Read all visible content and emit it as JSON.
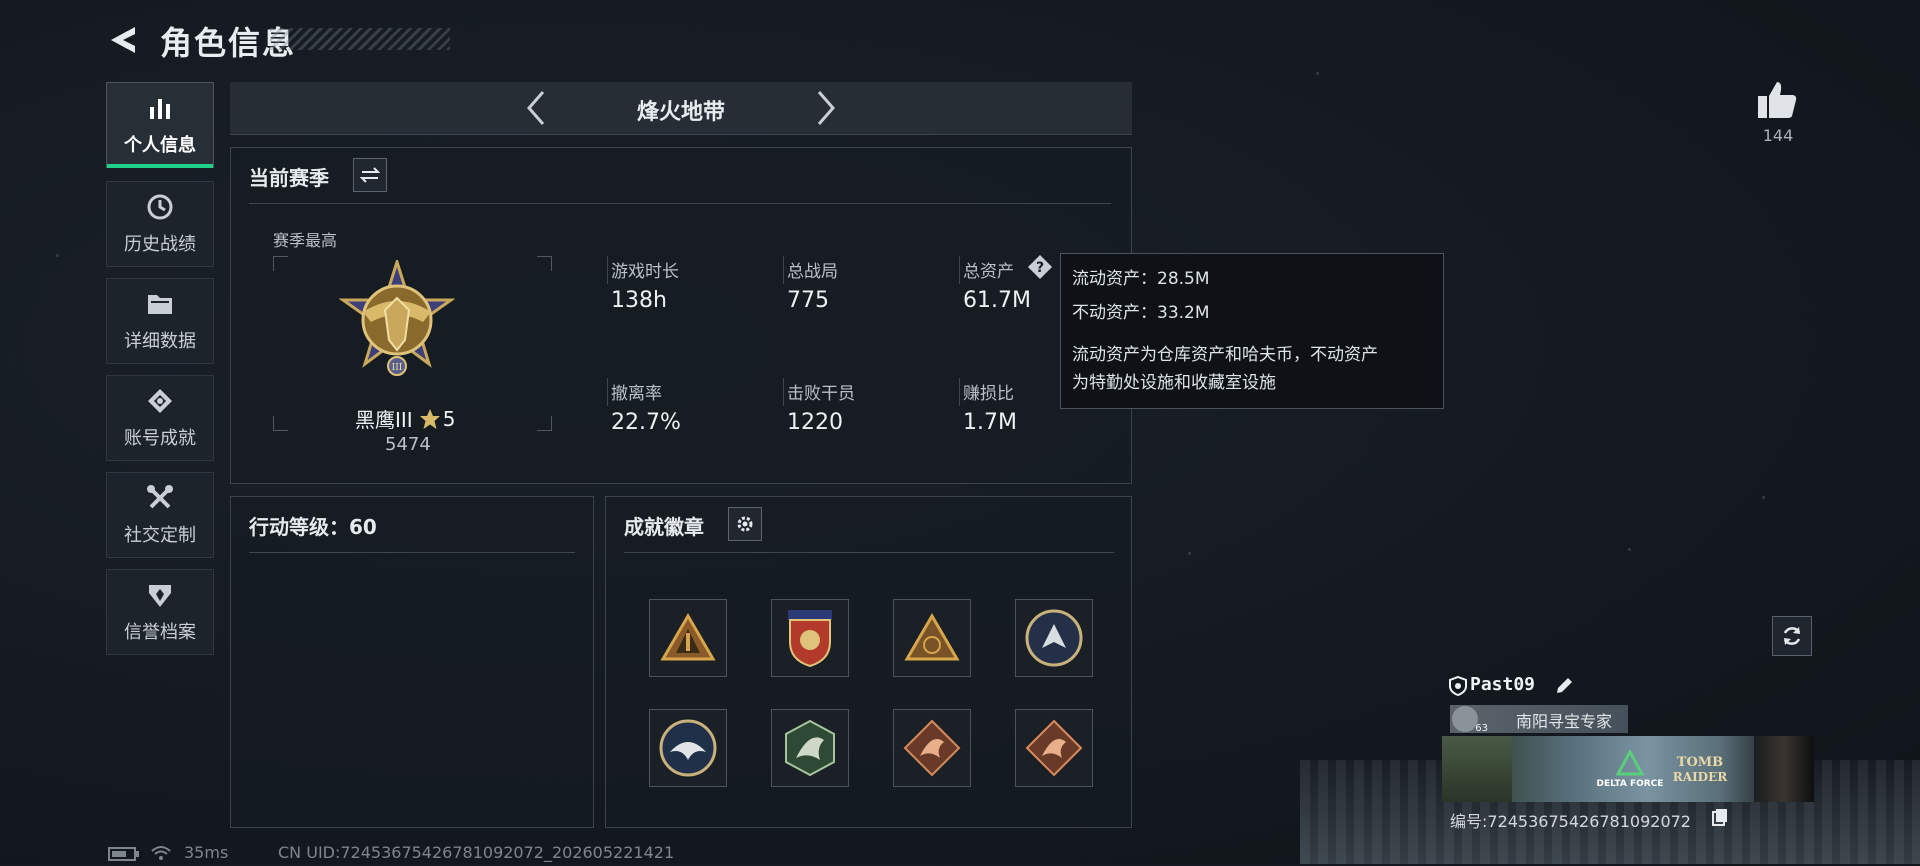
{
  "header": {
    "title": "角色信息"
  },
  "sidebar": {
    "items": [
      {
        "label": "个人信息",
        "icon": "bar-chart-icon",
        "active": true
      },
      {
        "label": "历史战绩",
        "icon": "history-icon"
      },
      {
        "label": "详细数据",
        "icon": "folder-icon"
      },
      {
        "label": "账号成就",
        "icon": "achievement-icon"
      },
      {
        "label": "社交定制",
        "icon": "tools-icon"
      },
      {
        "label": "信誉档案",
        "icon": "credit-icon"
      }
    ]
  },
  "mode": {
    "title": "烽火地带"
  },
  "season": {
    "title": "当前赛季",
    "best_label": "赛季最高",
    "rank_name": "黑鹰III",
    "rank_stars": "5",
    "rank_score": "5474",
    "stats": [
      {
        "label": "游戏时长",
        "value": "138h"
      },
      {
        "label": "总战局",
        "value": "775"
      },
      {
        "label": "总资产",
        "value": "61.7M"
      },
      {
        "label": "撤离率",
        "value": "22.7%"
      },
      {
        "label": "击败干员",
        "value": "1220"
      },
      {
        "label": "赚损比",
        "value": "1.7M"
      }
    ]
  },
  "tooltip": {
    "liquid": "流动资产：28.5M",
    "fixed": "不动资产：33.2M",
    "desc_line1": "流动资产为仓库资产和哈夫币，不动资产",
    "desc_line2": "为特勤处设施和收藏室设施"
  },
  "action_level": {
    "title": "行动等级：60"
  },
  "badges": {
    "title": "成就徽章",
    "items": [
      "triangle-badge-1",
      "shield-badge",
      "triangle-badge-2",
      "wolf-badge",
      "eagle-badge",
      "dragon-badge-green",
      "dragon-badge-copper-1",
      "dragon-badge-copper-2"
    ]
  },
  "social": {
    "likes": "144"
  },
  "player": {
    "name": "Past09",
    "title": "南阳寻宝专家",
    "level_small": "63",
    "id_label": "编号:72453675426781092072"
  },
  "footer": {
    "ping": "35ms",
    "uid": "CN UID:72453675426781092072_202605221421"
  },
  "colors": {
    "accent": "#1fd18a",
    "panel_border": "#3a444e",
    "background": "#141a20"
  }
}
